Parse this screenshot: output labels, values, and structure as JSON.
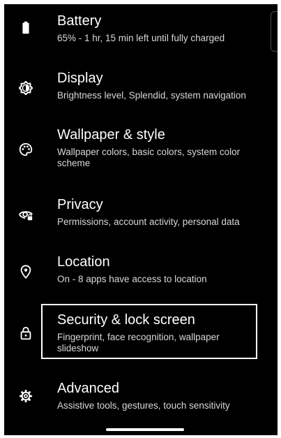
{
  "settings": {
    "items": [
      {
        "icon": "battery-icon",
        "title": "Battery",
        "subtitle": "65% - 1 hr, 15 min left until fully charged"
      },
      {
        "icon": "display-brightness-icon",
        "title": "Display",
        "subtitle": "Brightness level, Splendid, system navigation"
      },
      {
        "icon": "palette-icon",
        "title": "Wallpaper & style",
        "subtitle": "Wallpaper colors, basic colors, system color scheme"
      },
      {
        "icon": "privacy-eye-lock-icon",
        "title": "Privacy",
        "subtitle": "Permissions, account activity, personal data"
      },
      {
        "icon": "location-pin-icon",
        "title": "Location",
        "subtitle": "On - 8 apps have access to location"
      },
      {
        "icon": "lock-icon",
        "title": "Security & lock screen",
        "subtitle": "Fingerprint, face recognition, wallpaper slideshow"
      },
      {
        "icon": "gear-icon",
        "title": "Advanced",
        "subtitle": "Assistive tools, gestures, touch sensitivity"
      }
    ]
  },
  "colors": {
    "background": "#000000",
    "title": "#ffffff",
    "subtitle": "#d8d8d8",
    "highlight_border": "#ffffff"
  }
}
